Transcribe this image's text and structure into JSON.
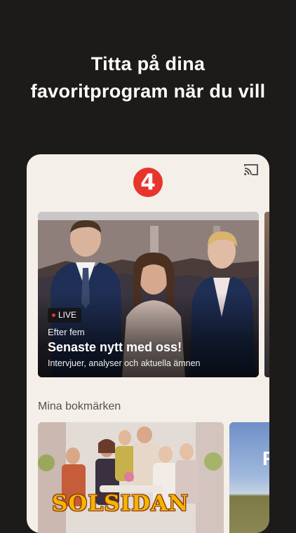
{
  "headline": {
    "line1": "Titta på dina",
    "line2": "favoritprogram när du vill"
  },
  "app": {
    "logo_text": "4"
  },
  "hero": {
    "live_label": "LIVE",
    "kicker": "Efter fem",
    "title": "Senaste nytt med oss!",
    "description": "Intervjuer, analyser och aktuella ämnen"
  },
  "bookmarks": {
    "section_title": "Mina bokmärken",
    "items": [
      {
        "title": "SOLSIDAN"
      },
      {
        "title": "F"
      }
    ]
  },
  "colors": {
    "brand_red": "#e8352c",
    "background": "#1d1b1a",
    "card": "#f5efe9"
  },
  "icons": {
    "cast": "cast-icon",
    "live": "live-dot-icon"
  }
}
